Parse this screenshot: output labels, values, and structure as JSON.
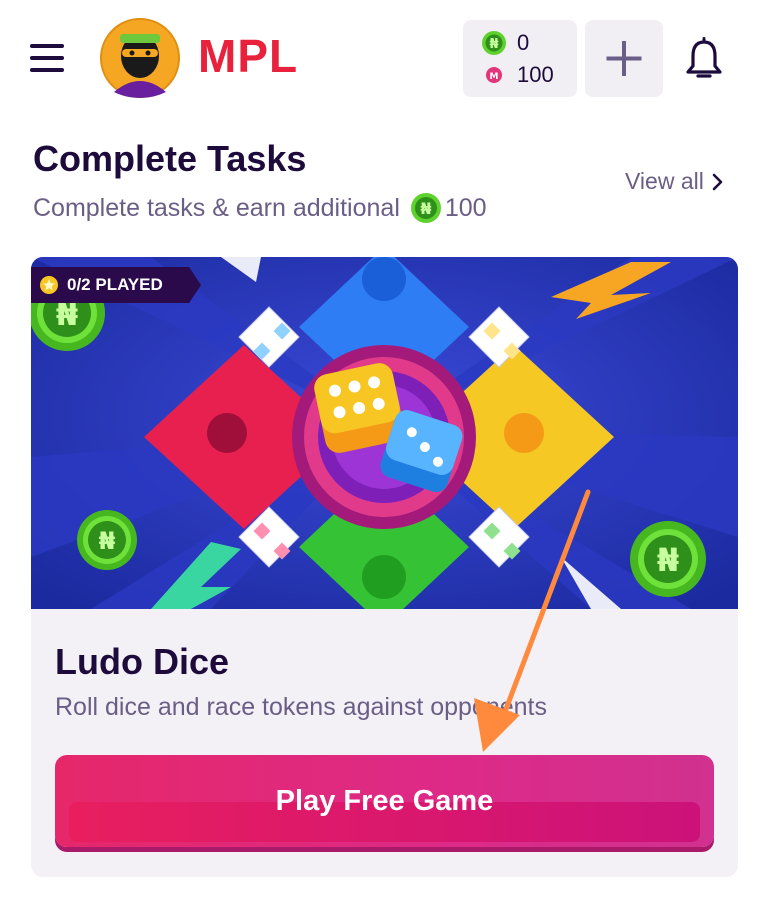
{
  "header": {
    "brand": "MPL",
    "wallet": {
      "coins": "0",
      "tokens": "100"
    }
  },
  "tasks": {
    "title": "Complete Tasks",
    "subtitle": "Complete tasks & earn additional",
    "reward": "100",
    "view_all": "View all"
  },
  "game": {
    "badge": "0/2 PLAYED",
    "title": "Ludo Dice",
    "description": "Roll dice and race tokens against opponents",
    "play_button": "Play Free Game"
  },
  "colors": {
    "primary_text": "#1d0b3c",
    "secondary_text": "#6b5e86",
    "brand_red": "#e8223c",
    "button": "#e6286a",
    "coin_green": "#5fd12d",
    "annotation_arrow": "#ff8a3d"
  }
}
